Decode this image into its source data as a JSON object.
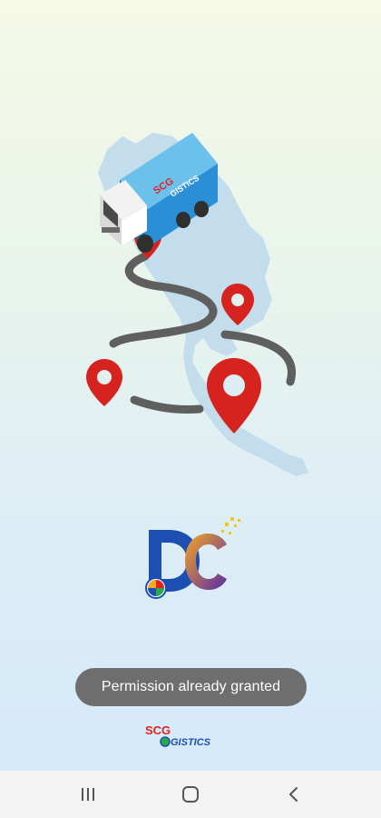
{
  "toast": {
    "message": "Permission already granted"
  },
  "truck": {
    "brand_top": "SCG",
    "brand_bottom": "GISTICS"
  },
  "dc_logo": {
    "text": "DC"
  },
  "footer_logo": {
    "brand_top": "SCG",
    "brand_bottom": "GISTICS"
  },
  "colors": {
    "route": "#5f5f5f",
    "pin": "#d7231f",
    "map": "#c4ddec",
    "truck_box": "#2a8fd6",
    "brand_red": "#e3221c",
    "brand_blue": "#1d4fb3",
    "dc_orange": "#f08a1c",
    "dc_purple": "#5a2aa8"
  },
  "navigation": {
    "recents": "recents-icon",
    "home": "home-icon",
    "back": "back-icon"
  }
}
